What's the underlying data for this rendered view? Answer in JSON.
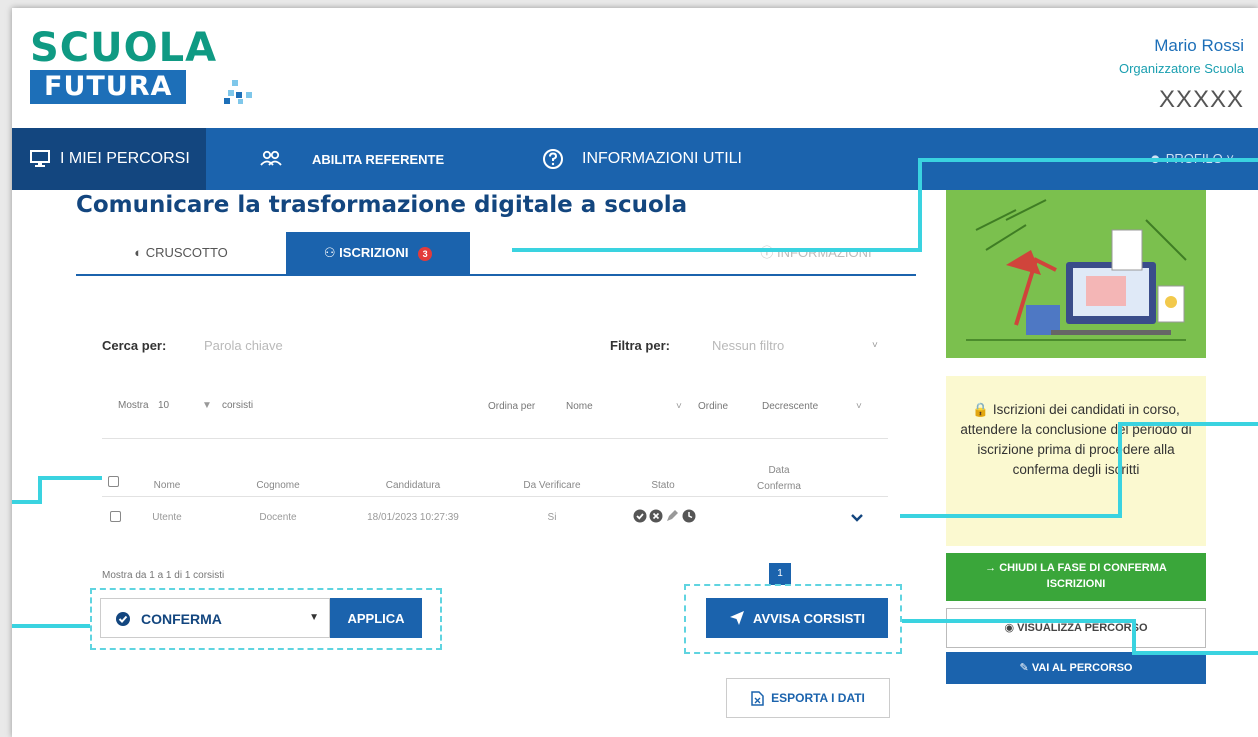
{
  "header": {
    "logo_line1": "SCUOLA",
    "logo_line2": "FUTURA",
    "user_name": "Mario Rossi",
    "user_role": "Organizzatore Scuola",
    "user_school": "XXXXX"
  },
  "nav": {
    "items": [
      {
        "label": "I MIEI PERCORSI",
        "icon": "monitor-icon"
      },
      {
        "label": "ABILITA REFERENTE",
        "icon": "users-icon"
      },
      {
        "label": "INFORMAZIONI UTILI",
        "icon": "help-circle-icon"
      }
    ],
    "profile": "PROFILO"
  },
  "page": {
    "title": "Comunicare la trasformazione digitale a scuola"
  },
  "tabs": [
    {
      "label": "CRUSCOTTO",
      "icon": "dashboard-icon"
    },
    {
      "label": "ISCRIZIONI",
      "icon": "users-icon",
      "badge": "3"
    },
    {
      "label": "",
      "icon": ""
    },
    {
      "label": "INFORMAZIONI",
      "icon": "info-icon"
    }
  ],
  "filters": {
    "search_label": "Cerca per:",
    "search_placeholder": "Parola chiave",
    "filter_label": "Filtra per:",
    "filter_placeholder": "Nessun filtro",
    "show_label": "Mostra",
    "show_value": "10",
    "show_suffix": "corsisti",
    "order_by_label": "Ordina per",
    "order_by_value": "Nome",
    "order_label": "Ordine",
    "order_value": "Decrescente"
  },
  "table": {
    "headers": [
      "Nome",
      "Cognome",
      "Candidatura",
      "Da Verificare",
      "Stato",
      "Data Conferma"
    ],
    "rows": [
      {
        "nome": "Utente",
        "cognome": "Docente",
        "candidatura": "18/01/2023 10:27:39",
        "da_verificare": "Si"
      }
    ]
  },
  "pagination": {
    "summary": "Mostra da 1 a 1 di 1 corsisti",
    "current_page": "1"
  },
  "actions": {
    "bulk_select": "CONFERMA",
    "apply": "APPLICA",
    "notify": "AVVISA CORSISTI",
    "export": "ESPORTA I DATI"
  },
  "sidebar": {
    "notice": "Iscrizioni dei candidati in corso, attendere la conclusione del periodo di iscrizione prima di procedere alla conferma degli iscritti",
    "close_phase": "CHIUDI LA FASE DI CONFERMA ISCRIZIONI",
    "view_course": "VISUALIZZA PERCORSO",
    "go_to_course": "VAI AL PERCORSO"
  },
  "colors": {
    "primary": "#1b63ad",
    "primary_dark": "#13467f",
    "logo_green": "#0f9a83",
    "success": "#3aa63a",
    "callout": "#3ad3e0",
    "notice_bg": "#fbf9d0"
  }
}
